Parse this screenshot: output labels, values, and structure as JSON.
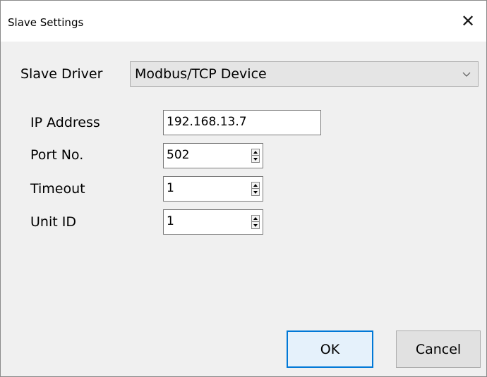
{
  "window": {
    "title": "Slave Settings",
    "close_symbol": "✕"
  },
  "slave_driver": {
    "label": "Slave Driver",
    "value": "Modbus/TCP Device"
  },
  "ip_address": {
    "label": "IP Address",
    "value": "192.168.13.7"
  },
  "port_no": {
    "label": "Port No.",
    "value": "502"
  },
  "timeout": {
    "label": "Timeout",
    "value": "1"
  },
  "unit_id": {
    "label": "Unit ID",
    "value": "1"
  },
  "buttons": {
    "ok": "OK",
    "cancel": "Cancel"
  },
  "colors": {
    "accent": "#0078d7",
    "dialog_bg": "#f0f0f0"
  }
}
